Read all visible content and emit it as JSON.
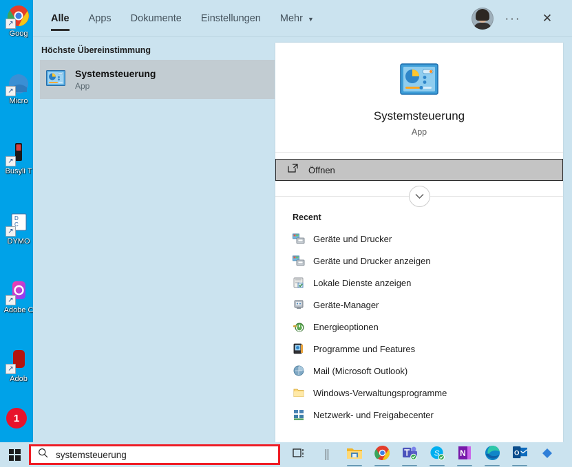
{
  "desktop": {
    "icons": [
      {
        "label": "Goog",
        "name": "desktop-icon-google-chrome"
      },
      {
        "label": "Micro",
        "name": "desktop-icon-microsoft"
      },
      {
        "label": "Busyli\nT",
        "name": "desktop-icon-busylight"
      },
      {
        "label": "DYMO",
        "name": "desktop-icon-dymo"
      },
      {
        "label": "Adobe C",
        "name": "desktop-icon-adobe-creative-cloud"
      },
      {
        "label": "Adob",
        "name": "desktop-icon-adobe-reader"
      }
    ]
  },
  "flyout": {
    "tabs": [
      {
        "label": "Alle",
        "active": true
      },
      {
        "label": "Apps",
        "active": false
      },
      {
        "label": "Dokumente",
        "active": false
      },
      {
        "label": "Einstellungen",
        "active": false
      },
      {
        "label": "Mehr",
        "active": false,
        "caret": "▼"
      }
    ],
    "more_caret": "▼",
    "overflow_dots": "···",
    "close_glyph": "✕"
  },
  "left": {
    "section_header": "Höchste Übereinstimmung",
    "best_match": {
      "title": "Systemsteuerung",
      "subtitle": "App"
    }
  },
  "card": {
    "app_name": "Systemsteuerung",
    "app_type": "App",
    "open_label": "Öffnen",
    "chevron_glyph": "⌄",
    "recent_header": "Recent",
    "recent_items": [
      {
        "label": "Geräte und Drucker",
        "icon": "devices-printers-icon"
      },
      {
        "label": "Geräte und Drucker anzeigen",
        "icon": "devices-printers-icon"
      },
      {
        "label": "Lokale Dienste anzeigen",
        "icon": "services-icon"
      },
      {
        "label": "Geräte-Manager",
        "icon": "device-manager-icon"
      },
      {
        "label": "Energieoptionen",
        "icon": "power-options-icon"
      },
      {
        "label": "Programme und Features",
        "icon": "programs-features-icon"
      },
      {
        "label": "Mail (Microsoft Outlook)",
        "icon": "mail-icon"
      },
      {
        "label": "Windows-Verwaltungsprogramme",
        "icon": "folder-icon"
      },
      {
        "label": "Netzwerk- und Freigabecenter",
        "icon": "network-sharing-icon"
      }
    ]
  },
  "taskbar": {
    "search_value": "systemsteuerung",
    "badge": "1",
    "items": [
      {
        "name": "task-view-icon"
      },
      {
        "name": "separator"
      },
      {
        "name": "file-explorer-icon"
      },
      {
        "name": "google-chrome-icon"
      },
      {
        "name": "microsoft-teams-icon"
      },
      {
        "name": "skype-icon"
      },
      {
        "name": "onenote-icon"
      },
      {
        "name": "microsoft-edge-icon"
      },
      {
        "name": "outlook-icon"
      },
      {
        "name": "diamond-app-icon"
      }
    ]
  },
  "colors": {
    "desktop_blue": "#00a2e8",
    "flyout_bg": "#cbe3ef",
    "selected_row": "#c2ccd2",
    "highlight_red": "#ee1c25",
    "badge_red": "#e8132b"
  }
}
